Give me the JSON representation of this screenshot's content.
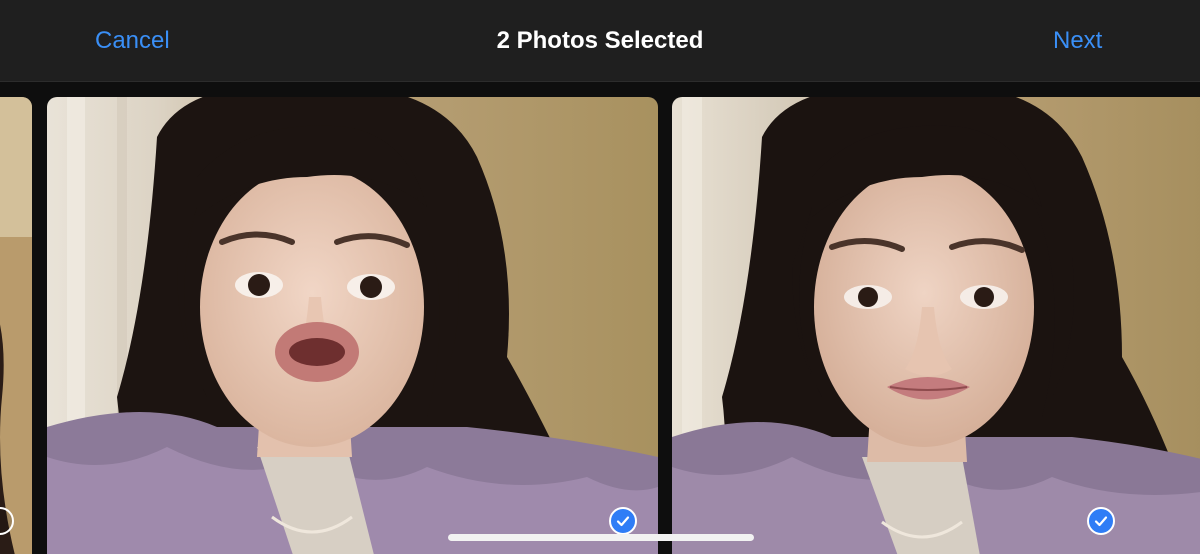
{
  "navbar": {
    "cancel_label": "Cancel",
    "title": "2 Photos Selected",
    "next_label": "Next"
  },
  "colors": {
    "accent": "#3a8ff6",
    "navbar_bg": "#1f1f1f",
    "title_text": "#ffffff",
    "check_fill": "#2f7df6"
  },
  "photos": [
    {
      "selected": false,
      "icon": "unselected-circle-icon"
    },
    {
      "selected": true,
      "icon": "checkmark-icon"
    },
    {
      "selected": true,
      "icon": "checkmark-icon"
    }
  ]
}
